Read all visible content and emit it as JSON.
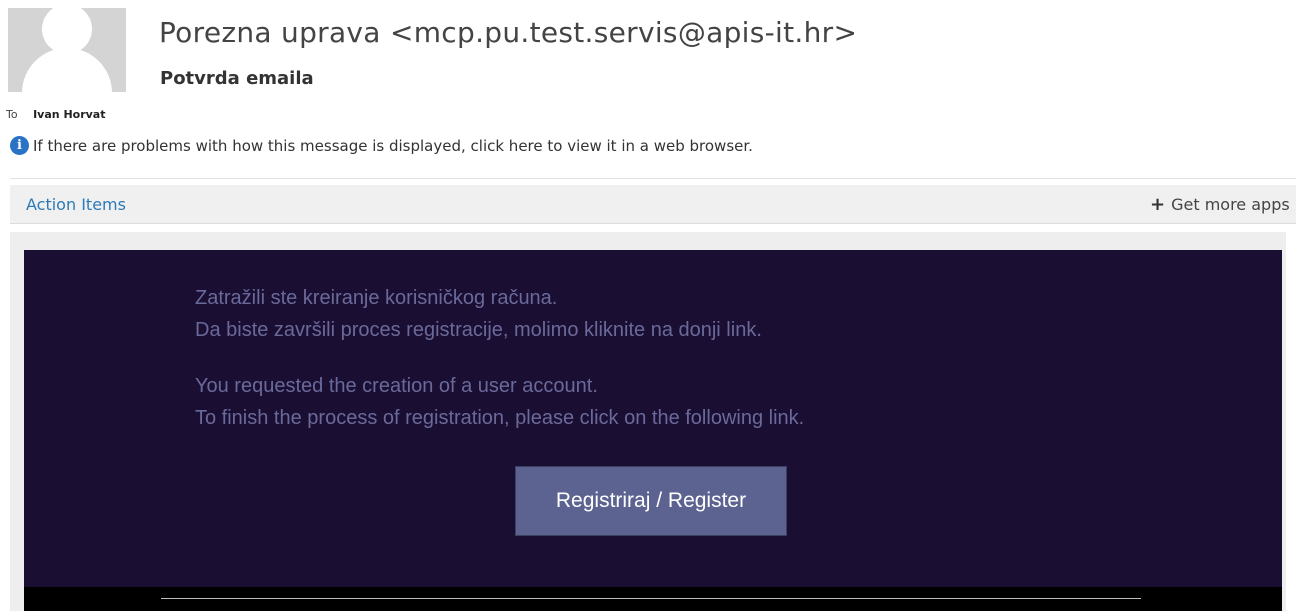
{
  "header": {
    "sender": "Porezna uprava <mcp.pu.test.servis@apis-it.hr>",
    "subject": "Potvrda emaila",
    "to_label": "To",
    "to_name": "Ivan Horvat",
    "info_message": "If there are problems with how this message is displayed, click here to view it in a web browser.",
    "info_icon": "info-icon"
  },
  "action_bar": {
    "action_items_label": "Action Items",
    "get_more_label": "Get more apps",
    "plus_icon": "plus-icon"
  },
  "email_body": {
    "line1": "Zatražili ste kreiranje korisničkog računa.",
    "line2": "Da biste završili proces registracije, molimo kliknite na donji link.",
    "line3": "You requested the creation of a user account.",
    "line4": "To finish the process of registration, please click on the following link.",
    "button_label": "Registriraj / Register"
  },
  "colors": {
    "panel_background": "#1b0e33",
    "text": "#6a6a9a",
    "button": "#5c6390",
    "link": "#2a7ab8"
  }
}
